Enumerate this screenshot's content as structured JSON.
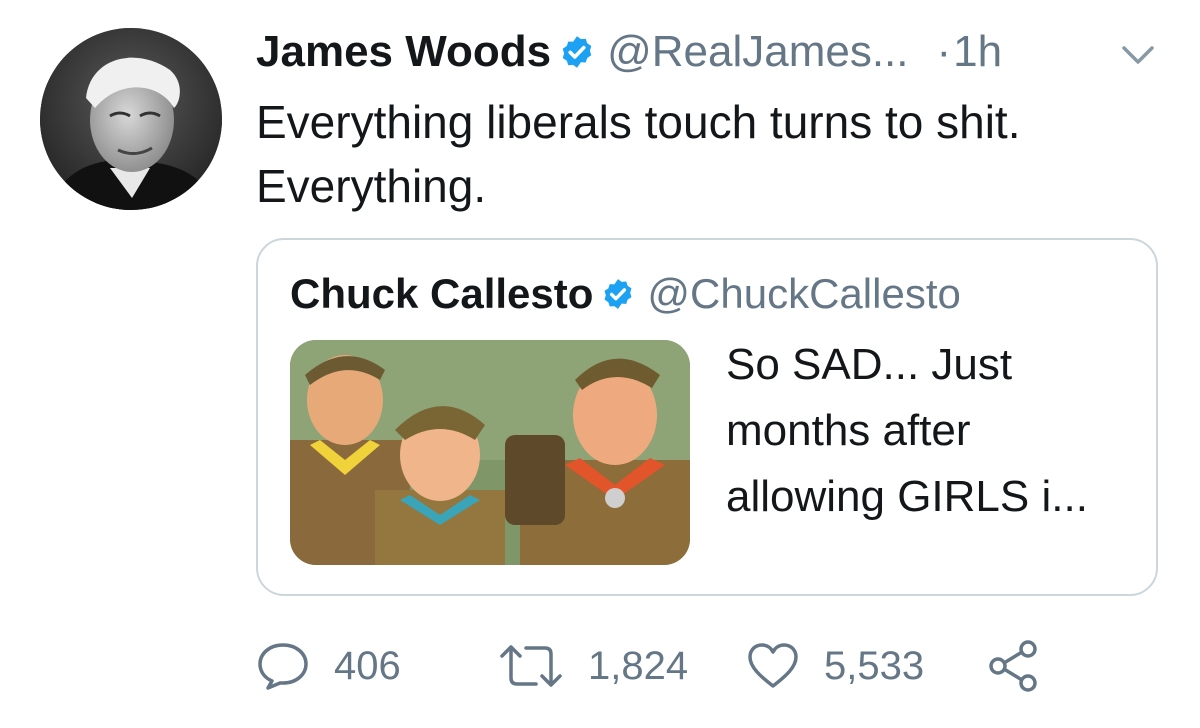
{
  "author": {
    "name": "James Woods",
    "handle": "@RealJames...",
    "separator": "·",
    "time": "1h",
    "verified": true
  },
  "tweet": {
    "text_line1": "Everything liberals touch turns to shit.",
    "text_line2": "Everything."
  },
  "quoted": {
    "name": "Chuck Callesto",
    "handle": "@ChuckCallesto",
    "verified": true,
    "text_line1": "So SAD...  Just",
    "text_line2": "months after",
    "text_line3": "allowing GIRLS i...",
    "media_icon": "boy-scouts-illustration"
  },
  "actions": {
    "replies": "406",
    "retweets": "1,824",
    "likes": "5,533"
  },
  "icons": {
    "verified": "verified-badge-icon",
    "chevron": "chevron-down-icon",
    "reply": "reply-bubble-icon",
    "retweet": "retweet-icon",
    "like": "heart-icon",
    "share": "share-icon"
  },
  "colors": {
    "text": "#14171a",
    "secondary": "#657786",
    "verified": "#1da1f2",
    "border": "#ccd6dd"
  }
}
